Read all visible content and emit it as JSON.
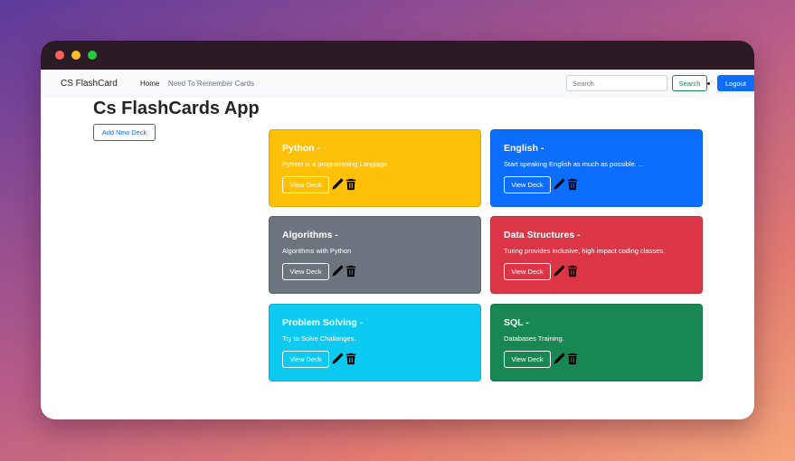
{
  "navbar": {
    "brand": "CS FlashCard",
    "links": [
      "Home",
      "Need To Remember Cards"
    ],
    "search_placeholder": "Search",
    "search_button": "Search",
    "logout_button": "Logout"
  },
  "main": {
    "title": "Cs FlashCards App",
    "add_button": "Add New Deck"
  },
  "decks": [
    {
      "title": "Python -",
      "description": "Python is a programming Langiage",
      "view_label": "View Deck",
      "color": "#ffc107"
    },
    {
      "title": "English -",
      "description": "Start speaking English as much as possible. ...",
      "view_label": "View Deck",
      "color": "#0d6efd"
    },
    {
      "title": "Algorithms -",
      "description": "Algorithms with Python",
      "view_label": "View Deck",
      "color": "#6c757d"
    },
    {
      "title": "Data Structures -",
      "description": "Turing provides inclusive, high impact coding classes.",
      "view_label": "View Deck",
      "color": "#dc3545"
    },
    {
      "title": "Problem Solving -",
      "description": "Try to Solve Challanges.",
      "view_label": "View Deck",
      "color": "#0dcaf0"
    },
    {
      "title": "SQL -",
      "description": "Databases Training.",
      "view_label": "View Deck",
      "color": "#198754"
    }
  ],
  "icons": {
    "edit": "pencil-icon",
    "delete": "trash-icon"
  }
}
